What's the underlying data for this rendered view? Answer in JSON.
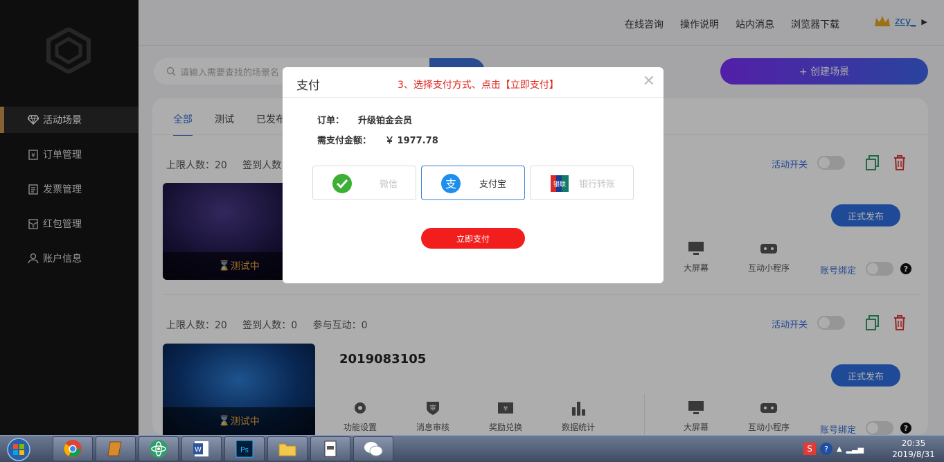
{
  "sidebar": {
    "items": [
      {
        "label": "活动场景",
        "icon": "diamond-icon",
        "active": true
      },
      {
        "label": "订单管理",
        "icon": "order-icon"
      },
      {
        "label": "发票管理",
        "icon": "invoice-icon"
      },
      {
        "label": "红包管理",
        "icon": "red-packet-icon"
      },
      {
        "label": "账户信息",
        "icon": "user-icon"
      }
    ]
  },
  "header": {
    "links": [
      "在线咨询",
      "操作说明",
      "站内消息",
      "浏览器下载"
    ],
    "username": "zcy_"
  },
  "search": {
    "placeholder": "请输入需要查找的场景名"
  },
  "create_button": "+ 创建场景",
  "tabs": [
    "全部",
    "测试",
    "已发布"
  ],
  "cards": [
    {
      "stats": [
        "上限人数：20",
        "签到人数",
        ""
      ],
      "title": "",
      "status": "测试中",
      "switch_label": "活动开关",
      "publish": "正式发布",
      "bind_label": "账号绑定",
      "tools_right": [
        "大屏幕",
        "互动小程序"
      ]
    },
    {
      "stats": [
        "上限人数：20",
        "签到人数：0",
        "参与互动：0"
      ],
      "title": "2019083105",
      "status": "测试中",
      "switch_label": "活动开关",
      "publish": "正式发布",
      "bind_label": "账号绑定",
      "tools_left": [
        "功能设置",
        "消息审核",
        "奖励兑换",
        "数据统计"
      ],
      "tools_right": [
        "大屏幕",
        "互动小程序"
      ]
    }
  ],
  "modal": {
    "title": "支付",
    "hint": "3、选择支付方式、点击【立即支付】",
    "order_label": "订单：",
    "order_value": "升级铂金会员",
    "amount_label": "需支付金额：",
    "amount_value": "￥ 1977.78",
    "methods": [
      {
        "label": "微信",
        "icon": "wechat-pay-icon",
        "selected": false
      },
      {
        "label": "支付宝",
        "icon": "alipay-icon",
        "selected": true
      },
      {
        "label": "银行转账",
        "icon": "unionpay-icon",
        "selected": false
      }
    ],
    "submit": "立即支付"
  },
  "taskbar": {
    "time": "20:35",
    "date": "2019/8/31"
  },
  "colors": {
    "accent": "#3b6fd8",
    "danger": "#f21d1d",
    "brand_gold": "#c4924f"
  }
}
